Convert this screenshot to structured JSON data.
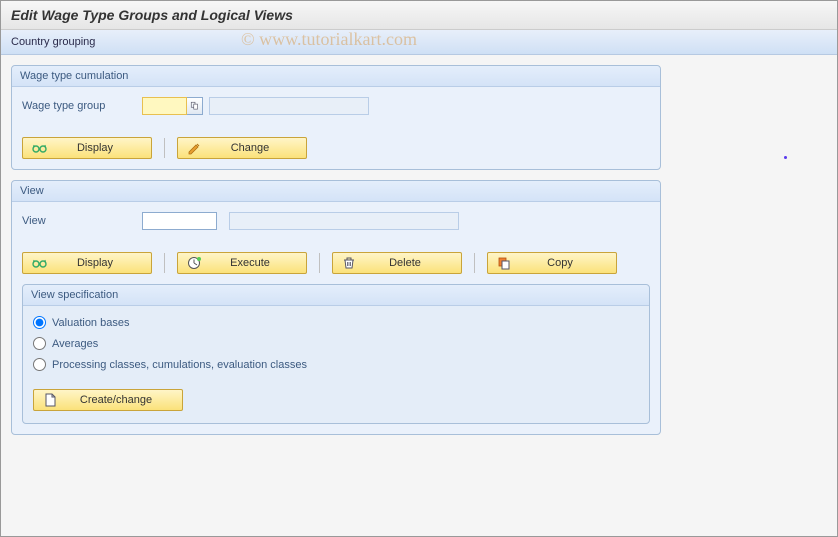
{
  "title": "Edit Wage Type Groups and Logical Views",
  "watermark": "© www.tutorialkart.com",
  "toolbar": {
    "country_grouping_label": "Country grouping"
  },
  "panel_wage": {
    "title": "Wage type cumulation",
    "group_label": "Wage type group",
    "group_value": "",
    "group_desc": "",
    "display_btn": "Display",
    "change_btn": "Change"
  },
  "panel_view": {
    "title": "View",
    "view_label": "View",
    "view_value": "",
    "view_desc": "",
    "display_btn": "Display",
    "execute_btn": "Execute",
    "delete_btn": "Delete",
    "copy_btn": "Copy",
    "spec_title": "View specification",
    "radio1": "Valuation bases",
    "radio2": "Averages",
    "radio3": "Processing classes, cumulations, evaluation classes",
    "create_btn": "Create/change"
  }
}
